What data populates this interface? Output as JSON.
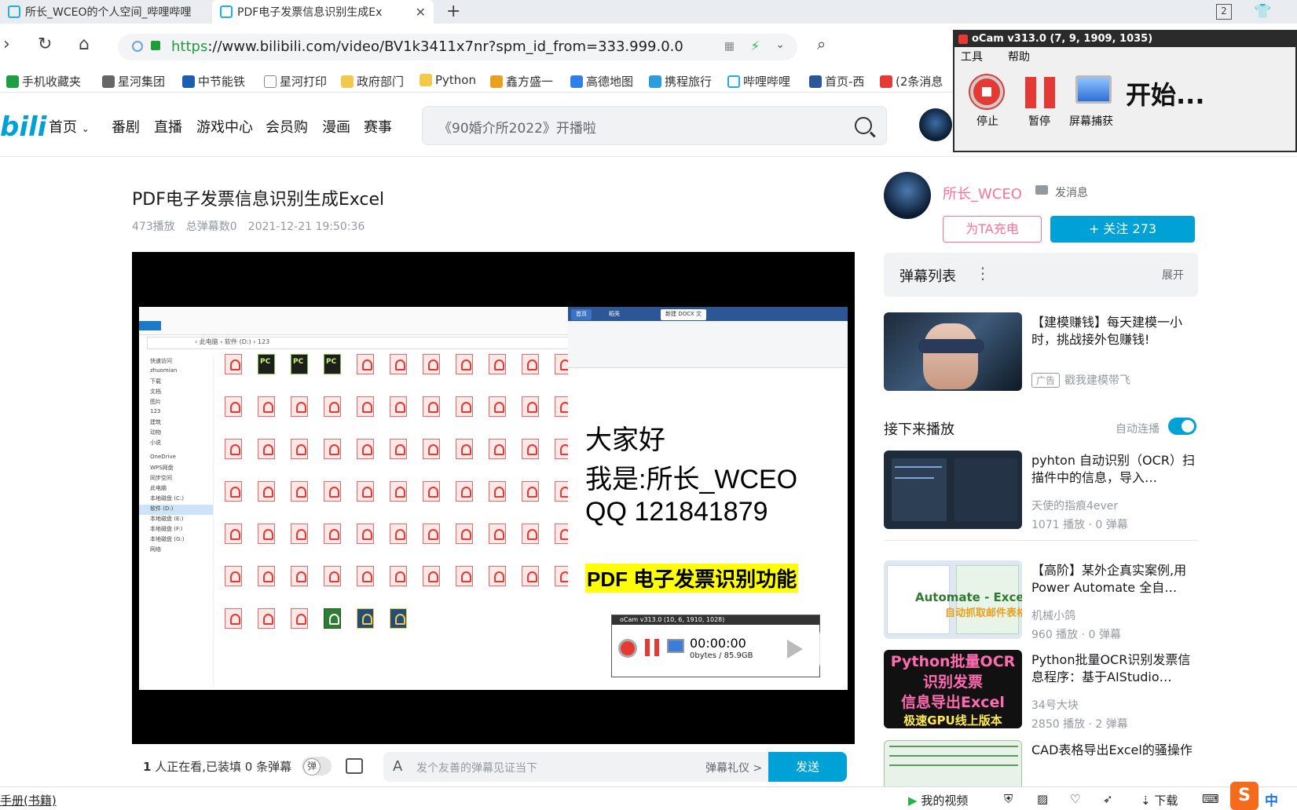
{
  "browser": {
    "tabs": [
      {
        "label": "所长_WCEO的个人空间_哔哩哔哩",
        "active": false
      },
      {
        "label": "PDF电子发票信息识别生成Ex",
        "active": true
      }
    ],
    "tab_count": "2",
    "url_scheme": "https",
    "url_rest": "://www.bilibili.com/video/BV1k3411x7nr?spm_id_from=333.999.0.0",
    "bookmarks": [
      "手机收藏夹",
      "星河集团",
      "中节能铁",
      "星河打印",
      "政府部门",
      "Python",
      "鑫方盛一",
      "高德地图",
      "携程旅行",
      "哔哩哔哩",
      "首页-西",
      "(2条消息"
    ]
  },
  "header": {
    "logo": "bili",
    "nav": [
      "首页",
      "番剧",
      "直播",
      "游戏中心",
      "会员购",
      "漫画",
      "赛事"
    ],
    "search_placeholder": "《90婚介所2022》开播啦"
  },
  "video": {
    "title": "PDF电子发票信息识别生成Excel",
    "plays": "473播放",
    "danmaku_total": "总弹幕数0",
    "date": "2021-12-21 19:50:36",
    "doc_lines": [
      "大家好",
      "我是:所长_WCEO",
      "QQ 121841879"
    ],
    "doc_highlight": "PDF 电子发票识别功能",
    "mini_ocam_title": "oCam v313.0 (10, 6, 1910, 1028)",
    "mini_ocam_time": "00:00:00",
    "mini_ocam_size": "0bytes / 85.9GB"
  },
  "player_bar": {
    "viewers_count": "1",
    "viewers_text": "人正在看,已装填 0 条弹幕",
    "danmaku_placeholder": "发个友善的弹幕见证当下",
    "etiquette": "弹幕礼仪 >",
    "send": "发送"
  },
  "uploader": {
    "name": "所长_WCEO",
    "message": "发消息",
    "charge": "为TA充电",
    "follow": "+ 关注 273"
  },
  "danmaku_list": {
    "title": "弹幕列表",
    "expand": "展开"
  },
  "ad_card": {
    "title": "【建模赚钱】每天建模一小时，挑战接外包赚钱!",
    "badge": "广告",
    "author": "戳我建模带飞"
  },
  "next_up": {
    "title": "接下来播放",
    "autoplay": "自动连播",
    "videos": [
      {
        "title": "pyhton 自动识别（OCR）扫描件中的信息，导入…",
        "author": "天使的指痕4ever",
        "stats": "1071 播放 · 0 弹幕"
      },
      {
        "title": "【高阶】某外企真实案例,用Power Automate 全自…",
        "author": "机械小鸽",
        "stats": "960 播放 · 0 弹幕"
      },
      {
        "title": "Python批量OCR识别发票信息程序：基于AIStudio…",
        "author": "34号大块",
        "stats": "2850 播放 · 2 弹幕"
      },
      {
        "title": "CAD表格导出Excel的骚操作",
        "author": "",
        "stats": ""
      }
    ]
  },
  "thumbnails": {
    "automate_caption": "Automate - Excel",
    "automate_sub": "自动抓取邮件表格",
    "ocr_lines": [
      "Python批量OCR",
      "识别发票",
      "信息导出Excel",
      "极速GPU线上版本"
    ]
  },
  "ocam": {
    "title": "oCam v313.0 (7, 9, 1909, 1035)",
    "menu": [
      "工具",
      "帮助"
    ],
    "stop": "停止",
    "pause": "暂停",
    "capture": "屏幕捕获",
    "start": "开始..."
  },
  "statusbar": {
    "left": "手册(书籍)",
    "my_video": "我的视频",
    "download": "下载",
    "ime": "中"
  }
}
